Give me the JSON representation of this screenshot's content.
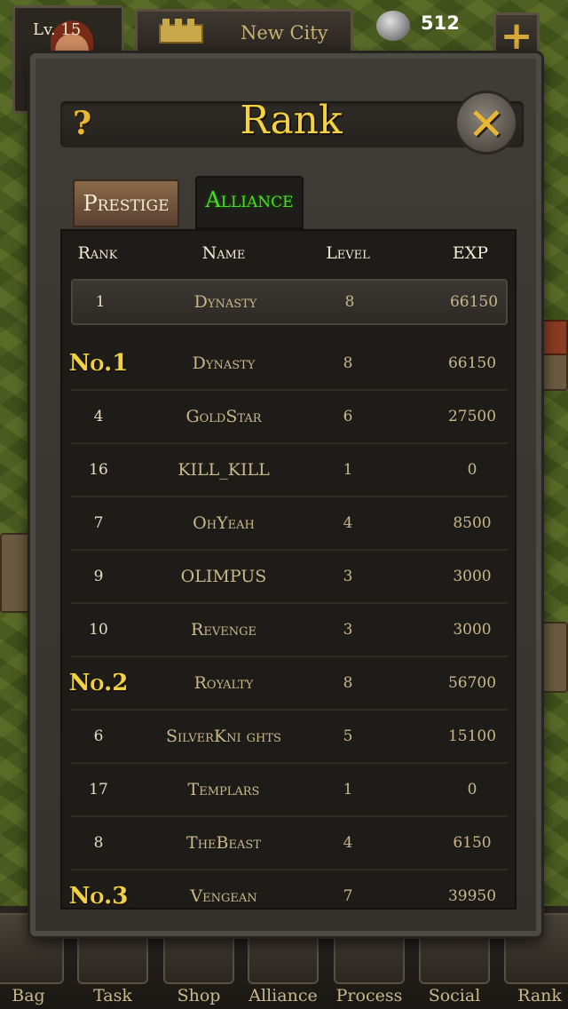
{
  "topbar": {
    "level": "Lv. 15",
    "city_name": "New City",
    "coins": "512",
    "plus_label": "+"
  },
  "modal": {
    "help_label": "?",
    "title": "Rank",
    "close_label": "✕",
    "tabs": [
      {
        "label": "Prestige",
        "active": false
      },
      {
        "label": "Alliance",
        "active": true
      }
    ],
    "columns": [
      "Rank",
      "Name",
      "Level",
      "EXP"
    ],
    "my_row": {
      "rank": "1",
      "name": "Dynasty",
      "level": "8",
      "exp": "66150"
    },
    "rows": [
      {
        "rank": "No.1",
        "name": "Dynasty",
        "level": "8",
        "exp": "66150",
        "medal": true
      },
      {
        "rank": "4",
        "name": "GoldStar",
        "level": "6",
        "exp": "27500",
        "medal": false
      },
      {
        "rank": "16",
        "name": "KILL_KILL",
        "level": "1",
        "exp": "0",
        "medal": false
      },
      {
        "rank": "7",
        "name": "OhYeah",
        "level": "4",
        "exp": "8500",
        "medal": false
      },
      {
        "rank": "9",
        "name": "OLIMPUS",
        "level": "3",
        "exp": "3000",
        "medal": false
      },
      {
        "rank": "10",
        "name": "Revenge",
        "level": "3",
        "exp": "3000",
        "medal": false
      },
      {
        "rank": "No.2",
        "name": "Royalty",
        "level": "8",
        "exp": "56700",
        "medal": true
      },
      {
        "rank": "6",
        "name": "SilverKni ghts",
        "level": "5",
        "exp": "15100",
        "medal": false
      },
      {
        "rank": "17",
        "name": "Templars",
        "level": "1",
        "exp": "0",
        "medal": false
      },
      {
        "rank": "8",
        "name": "TheBeast",
        "level": "4",
        "exp": "6150",
        "medal": false
      },
      {
        "rank": "No.3",
        "name": "Vengean",
        "level": "7",
        "exp": "39950",
        "medal": true
      }
    ]
  },
  "bottom_nav": [
    {
      "label": "Bag"
    },
    {
      "label": "Task"
    },
    {
      "label": "Shop"
    },
    {
      "label": "Alliance"
    },
    {
      "label": "Process"
    },
    {
      "label": "Social"
    },
    {
      "label": "Rank"
    }
  ]
}
